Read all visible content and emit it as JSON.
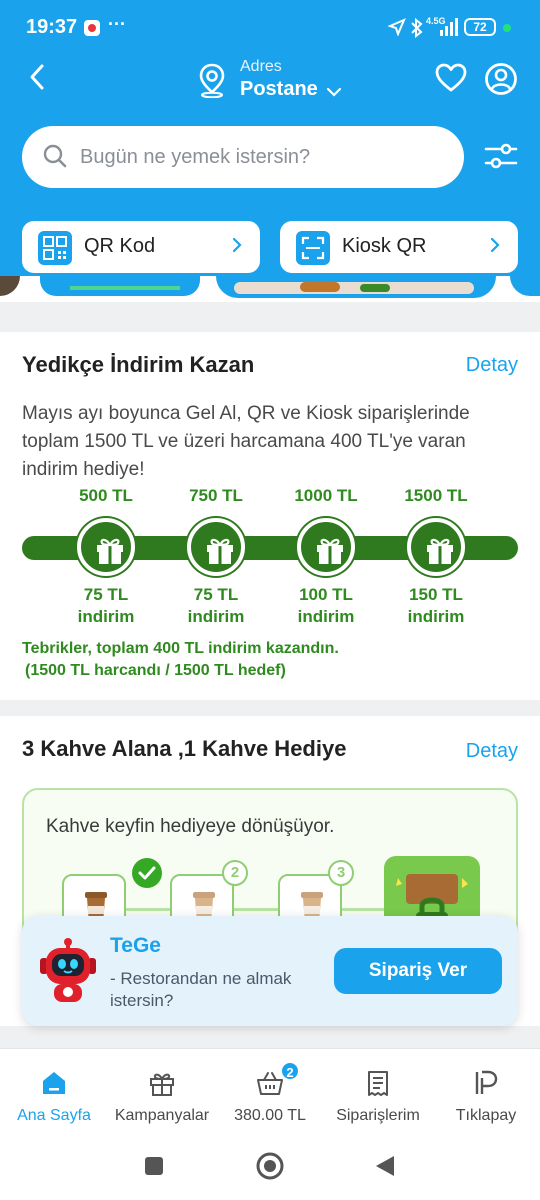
{
  "status_bar": {
    "time": "19:37",
    "more": "···",
    "network": "4.5G",
    "battery": "72"
  },
  "header": {
    "address_label": "Adres",
    "address_value": "Postane"
  },
  "search": {
    "placeholder": "Bugün ne yemek istersin?"
  },
  "quick_actions": [
    {
      "label": "QR Kod"
    },
    {
      "label": "Kiosk QR"
    }
  ],
  "campaign1": {
    "title": "Yedikçe İndirim Kazan",
    "link": "Detay",
    "description": "Mayıs ayı boyunca Gel Al, QR ve Kiosk siparişlerinde toplam 1500 TL ve üzeri harcamana 400 TL'ye varan indirim hediye!",
    "steps": [
      {
        "spend": "500 TL",
        "discount": "75 TL",
        "unit": "indirim"
      },
      {
        "spend": "750 TL",
        "discount": "75 TL",
        "unit": "indirim"
      },
      {
        "spend": "1000 TL",
        "discount": "100 TL",
        "unit": "indirim"
      },
      {
        "spend": "1500 TL",
        "discount": "150 TL",
        "unit": "indirim"
      }
    ],
    "congrats_line1": "Tebrikler, toplam 400 TL indirim kazandın.",
    "congrats_line2": "(1500 TL harcandı / 1500 TL hedef)"
  },
  "campaign2": {
    "title": "3 Kahve Alana ,1 Kahve Hediye",
    "link": "Detay",
    "subtitle": "Kahve keyfin hediyeye dönüşüyor.",
    "badges": [
      "2",
      "3"
    ]
  },
  "tege": {
    "name": "TeGe",
    "message": "- Restorandan ne almak istersin?",
    "button": "Sipariş Ver"
  },
  "bottom_nav": [
    {
      "label": "Ana Sayfa",
      "icon": "home-icon",
      "active": true
    },
    {
      "label": "Kampanyalar",
      "icon": "gift-icon"
    },
    {
      "label": "380.00 TL",
      "icon": "basket-icon",
      "badge": "2"
    },
    {
      "label": "Siparişlerim",
      "icon": "receipt-icon"
    },
    {
      "label": "Tıklapay",
      "icon": "tiklapay-icon"
    }
  ],
  "colors": {
    "brand": "#1aa3ec",
    "success": "#2f7a1f"
  }
}
